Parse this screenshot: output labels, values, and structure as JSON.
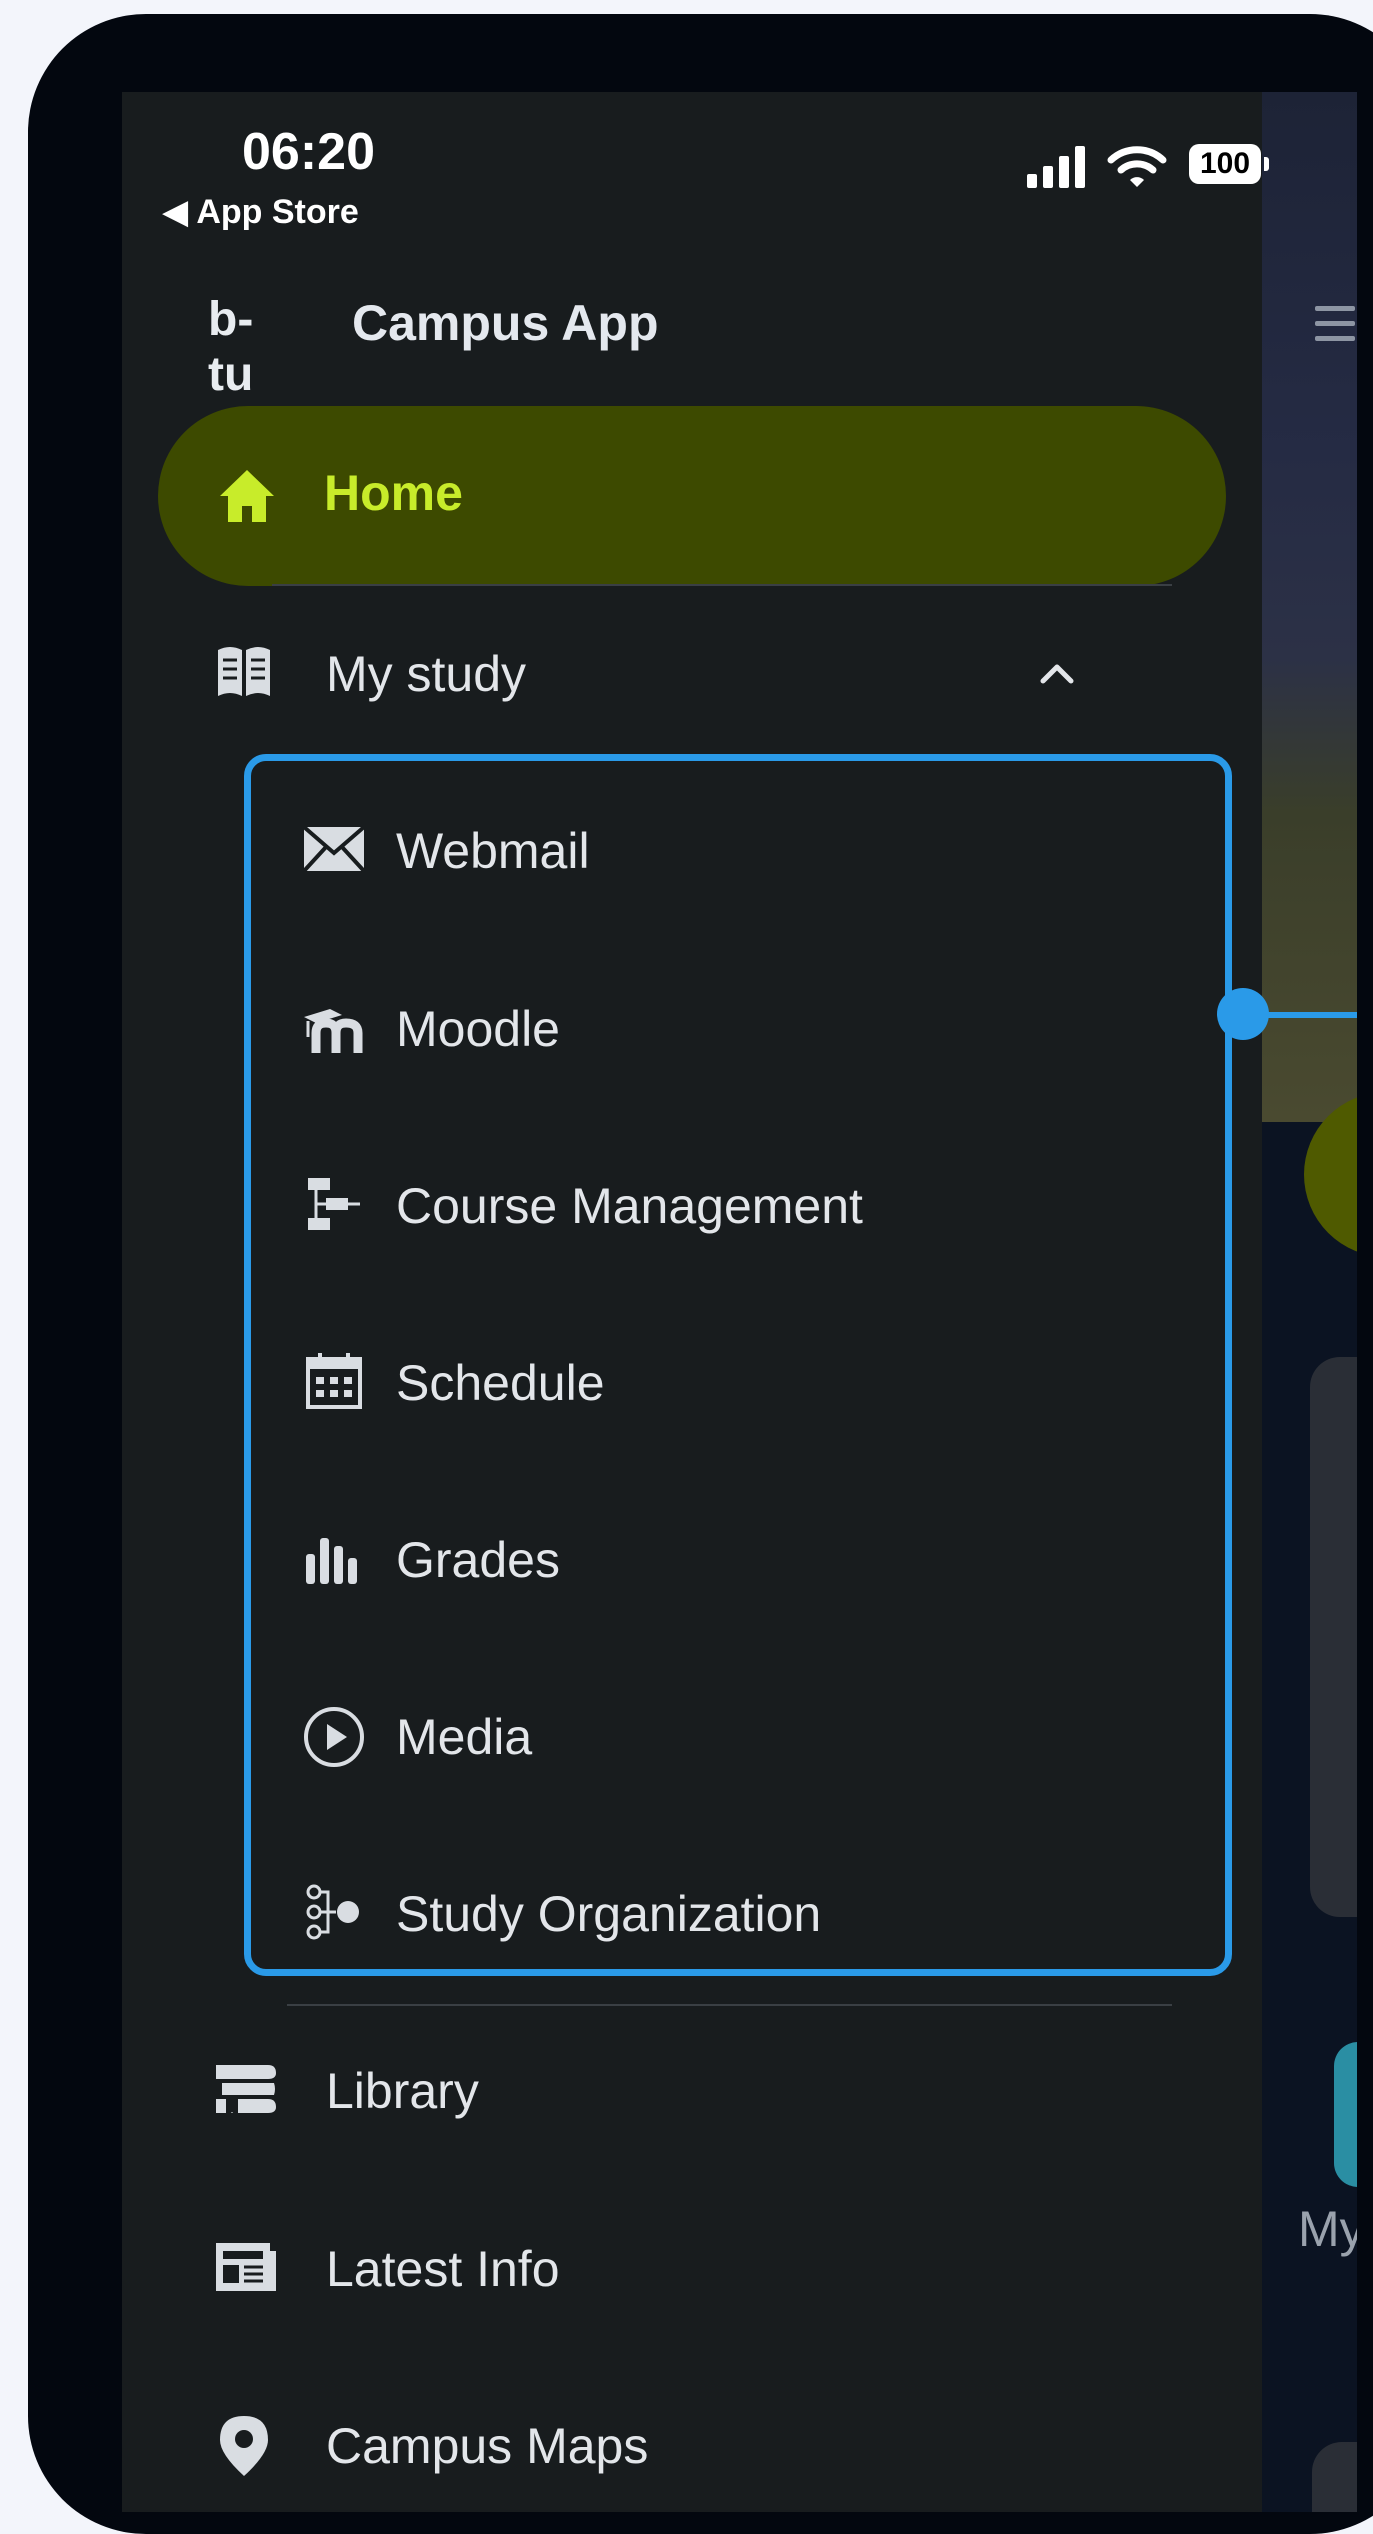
{
  "status_bar": {
    "time": "06:20",
    "back_label": "◀ App Store",
    "battery": "100"
  },
  "brand": {
    "logo_text": "b-tu",
    "title": "Campus App"
  },
  "nav": {
    "home": {
      "label": "Home",
      "icon": "home-icon"
    },
    "my_study": {
      "label": "My study",
      "icon": "book-icon",
      "expanded": true
    },
    "submenu": [
      {
        "label": "Webmail",
        "icon": "mail-icon"
      },
      {
        "label": "Moodle",
        "icon": "moodle-icon"
      },
      {
        "label": "Course Management",
        "icon": "sitemap-icon"
      },
      {
        "label": "Schedule",
        "icon": "calendar-icon"
      },
      {
        "label": "Grades",
        "icon": "bar-chart-icon"
      },
      {
        "label": "Media",
        "icon": "play-circle-icon"
      },
      {
        "label": "Study Organization",
        "icon": "organization-icon"
      }
    ],
    "library": {
      "label": "Library",
      "icon": "library-icon"
    },
    "latest_info": {
      "label": "Latest Info",
      "icon": "newspaper-icon"
    },
    "campus_maps": {
      "label": "Campus Maps",
      "icon": "map-pin-icon"
    }
  },
  "background": {
    "partial_label": "My"
  },
  "colors": {
    "drawer_bg": "#181c1e",
    "home_pill": "#3d4a00",
    "home_accent": "#c8ec2a",
    "highlight": "#2a9ae8",
    "text": "#e3e6ea"
  }
}
